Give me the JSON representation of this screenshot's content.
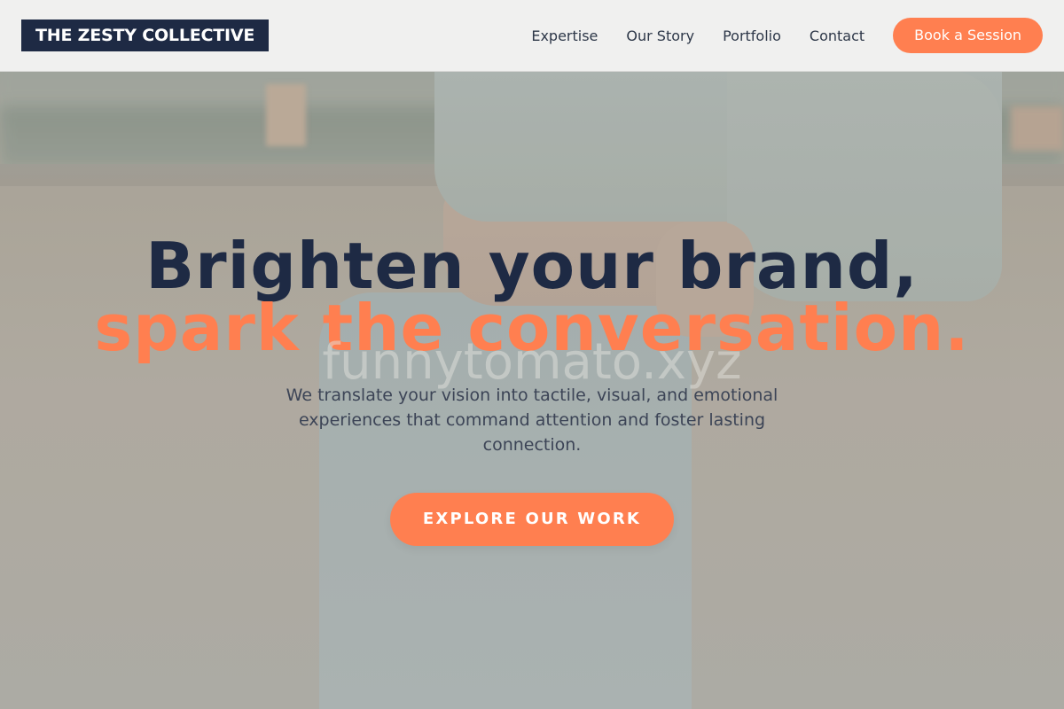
{
  "brand": {
    "logo_text": "THE ZESTY COLLECTIVE"
  },
  "nav": {
    "links": [
      "Expertise",
      "Our Story",
      "Portfolio",
      "Contact"
    ],
    "cta_label": "Book a Session"
  },
  "hero": {
    "headline_line1": "Brighten your brand,",
    "headline_line2": "spark the conversation.",
    "watermark": "funnytomato.xyz",
    "subtext": "We translate your vision into tactile, visual, and emotional experiences that command attention and foster lasting connection.",
    "cta_label": "EXPLORE OUR WORK"
  },
  "colors": {
    "navy": "#1e2a44",
    "coral": "#ff7f50",
    "header_bg": "#f3f3f2",
    "body_text": "#3c4456"
  }
}
